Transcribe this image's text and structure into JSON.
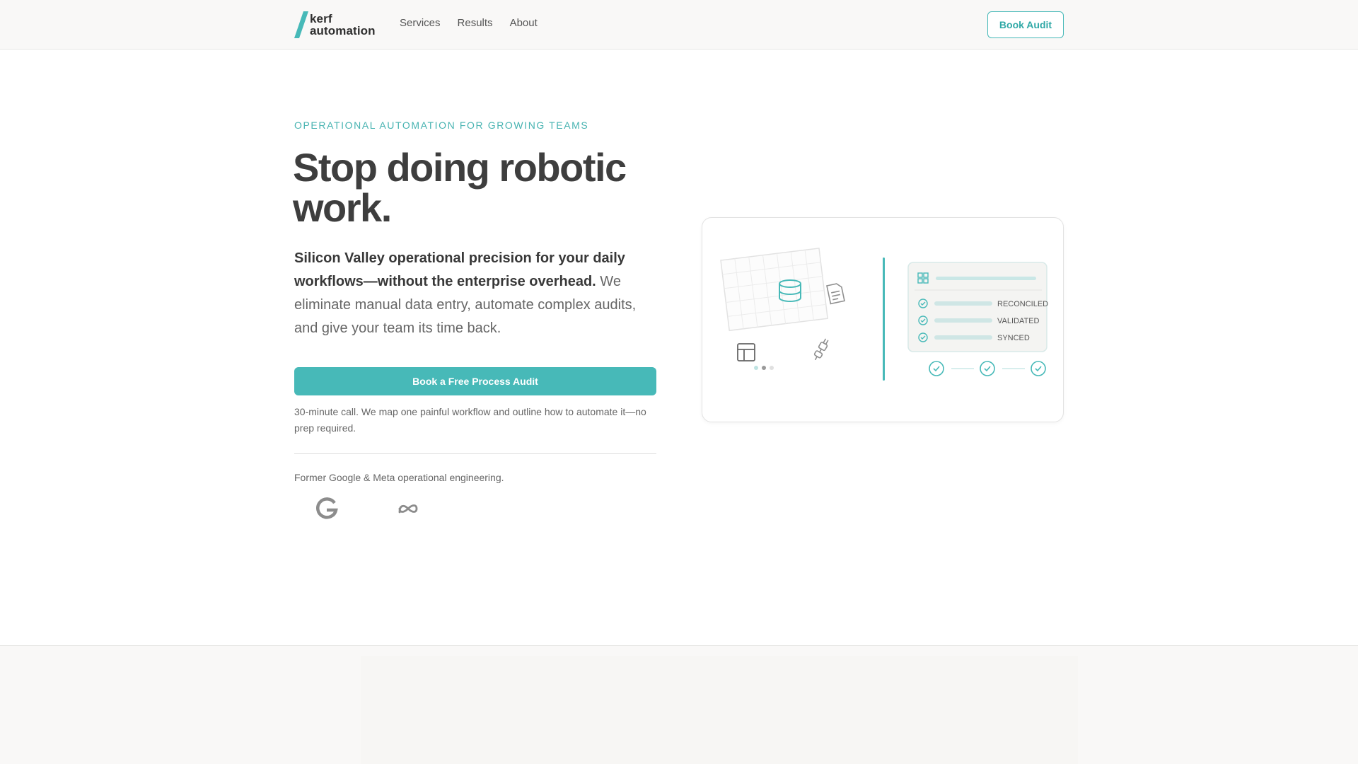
{
  "nav": {
    "brand": {
      "line1": "kerf",
      "line2": "automation"
    },
    "links": [
      {
        "label": "Services"
      },
      {
        "label": "Results"
      },
      {
        "label": "About"
      }
    ],
    "cta_label": "Book Audit"
  },
  "hero": {
    "eyebrow": "OPERATIONAL AUTOMATION FOR GROWING TEAMS",
    "headline": "Stop doing robotic work.",
    "subhead_bold": "Silicon Valley operational precision for your daily workflows—without the enterprise overhead.",
    "subhead_rest": " We eliminate manual data entry, automate complex audits, and give your team its time back.",
    "cta_label": "Book a Free Process Audit",
    "cta_note": "30-minute call. We map one painful workflow and outline how to automate it—no prep required.",
    "social_proof": "Former Google & Meta operational engineering."
  },
  "illustration": {
    "statuses": [
      {
        "label": "RECONCILED"
      },
      {
        "label": "VALIDATED"
      },
      {
        "label": "SYNCED"
      }
    ]
  },
  "colors": {
    "accent": "#47b9b8",
    "text_dark": "#3e3e3e",
    "nav_bg": "#f9f8f7"
  },
  "icons": [
    "logo-slash-icon",
    "google-logo-icon",
    "meta-logo-icon",
    "database-icon",
    "document-icon",
    "table-icon",
    "plug-icon",
    "dashboard-icon",
    "check-circle-icon"
  ]
}
